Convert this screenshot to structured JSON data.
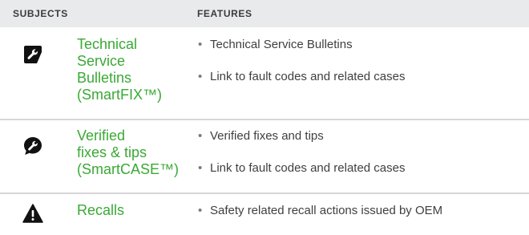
{
  "header": {
    "subjects": "SUBJECTS",
    "features": "FEATURES"
  },
  "rows": [
    {
      "icon": "wrench-icon",
      "subject": [
        "Technical",
        "Service",
        "Bulletins",
        "(SmartFIX™)"
      ],
      "features": [
        "Technical Service Bulletins",
        "Link to fault codes and related cases"
      ]
    },
    {
      "icon": "wrench-speech-bubble-icon",
      "subject": [
        "Verified",
        "fixes & tips",
        "(SmartCASE™)"
      ],
      "features": [
        "Verified fixes and tips",
        "Link to fault codes and related cases"
      ]
    },
    {
      "icon": "warning-triangle-icon",
      "subject": [
        "Recalls"
      ],
      "features": [
        "Safety related recall actions issued by OEM"
      ]
    }
  ],
  "bullet": "•",
  "colors": {
    "header_bg": "#e9eaec",
    "subject_green": "#3aa935",
    "divider": "#d6d6d6",
    "icon": "#111111"
  }
}
